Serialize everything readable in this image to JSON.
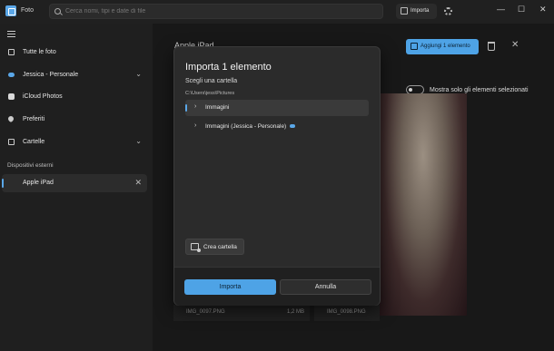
{
  "app": {
    "title": "Foto",
    "window_controls": [
      "—",
      "☐",
      "✕"
    ]
  },
  "search": {
    "placeholder": "Cerca nomi, tipi e date di file"
  },
  "toolbar": {
    "import_label": "Importa"
  },
  "sidebar": {
    "items": [
      {
        "label": "Tutte le foto",
        "icon": "image-icon"
      },
      {
        "label": "Jessica - Personale",
        "icon": "cloud-icon",
        "chevron": "⌄"
      },
      {
        "label": "iCloud Photos",
        "icon": "icloud-icon"
      },
      {
        "label": "Preferiti",
        "icon": "heart-icon"
      },
      {
        "label": "Cartelle",
        "icon": "folder-icon",
        "chevron": "⌄"
      }
    ],
    "section_label": "Dispositivi esterni",
    "device": {
      "label": "Apple iPad",
      "close": "✕"
    }
  },
  "main": {
    "behind_title": "Apple iPad",
    "add_button_label": "Aggiungi 1 elemento",
    "toggle_label": "Mostra solo gli elementi selezionati",
    "thumbs": [
      {
        "name": "IMG_0097.PNG",
        "size": "1,2 MB"
      },
      {
        "name": "IMG_0098.PNG",
        "size": ""
      }
    ]
  },
  "dialog": {
    "title": "Importa 1 elemento",
    "subtitle": "Scegli una cartella",
    "path": "C:\\Users\\jess\\Pictures",
    "tree": [
      {
        "label": "Immagini",
        "chevron": "›",
        "selected": true
      },
      {
        "label": "Immagini (Jessica - Personale)",
        "chevron": "›",
        "cloud": true
      }
    ],
    "new_folder_label": "Crea cartella",
    "confirm_label": "Importa",
    "cancel_label": "Annulla"
  },
  "colors": {
    "accent": "#4ea3e6",
    "background": "#1c1c1c",
    "dialog_bg": "#2b2b2b"
  }
}
